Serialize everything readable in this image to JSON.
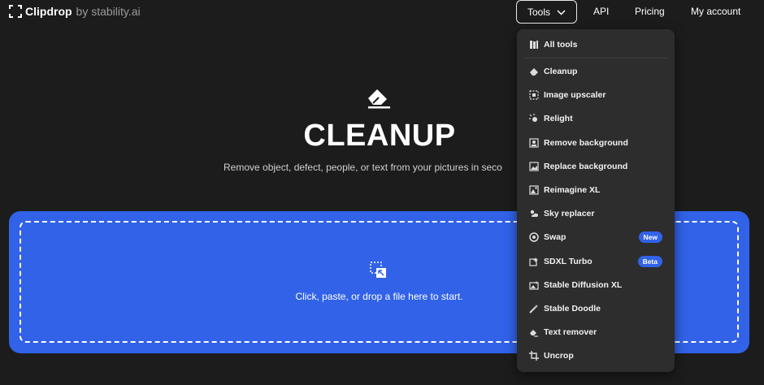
{
  "header": {
    "brand": "Clipdrop",
    "brand_suffix": "by stability.ai",
    "nav": {
      "tools": "Tools",
      "api": "API",
      "pricing": "Pricing",
      "account": "My account"
    }
  },
  "hero": {
    "title": "CLEANUP",
    "subtitle": "Remove object, defect, people, or text from your pictures in seco"
  },
  "dropzone": {
    "text": "Click, paste, or drop a file here to start."
  },
  "tools_menu": {
    "all_tools": "All tools",
    "items": [
      {
        "label": "Cleanup",
        "icon": "eraser-icon"
      },
      {
        "label": "Image upscaler",
        "icon": "upscale-icon"
      },
      {
        "label": "Relight",
        "icon": "relight-icon"
      },
      {
        "label": "Remove background",
        "icon": "remove-bg-icon"
      },
      {
        "label": "Replace background",
        "icon": "replace-bg-icon"
      },
      {
        "label": "Reimagine XL",
        "icon": "reimagine-icon"
      },
      {
        "label": "Sky replacer",
        "icon": "sky-icon"
      },
      {
        "label": "Swap",
        "icon": "swap-icon",
        "badge": "New"
      },
      {
        "label": "SDXL Turbo",
        "icon": "sdxl-icon",
        "badge": "Beta"
      },
      {
        "label": "Stable Diffusion XL",
        "icon": "stable-diffusion-icon"
      },
      {
        "label": "Stable Doodle",
        "icon": "doodle-icon"
      },
      {
        "label": "Text remover",
        "icon": "text-remover-icon"
      },
      {
        "label": "Uncrop",
        "icon": "uncrop-icon"
      }
    ]
  },
  "colors": {
    "background": "#1c1c1c",
    "accent": "#3162e8",
    "menu": "#2d2d2d"
  }
}
